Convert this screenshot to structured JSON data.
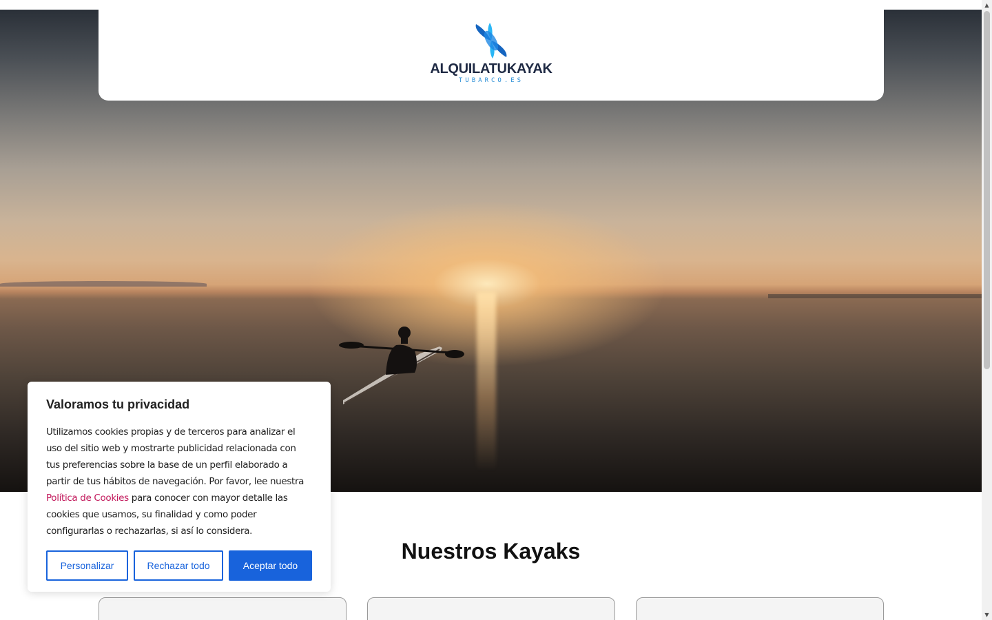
{
  "logo": {
    "name": "ALQUILATUKAYAK",
    "tagline": "TUBARCO.ES",
    "colors": {
      "primary": "#1565c0",
      "light": "#29b6f6",
      "text": "#1f2a44"
    }
  },
  "hero": {
    "image": "sunset-kayaker-photo"
  },
  "section": {
    "title": "Nuestros Kayaks"
  },
  "cookie_banner": {
    "title": "Valoramos tu privacidad",
    "text_before_link": "Utilizamos cookies propias y de terceros para analizar el uso del sitio web y mostrarte publicidad relacionada con tus preferencias sobre la base de un perfil elaborado a partir de tus hábitos de navegación. Por favor, lee nuestra ",
    "link_text": "Política de Cookies",
    "text_after_link": " para conocer con mayor detalle las cookies que usamos, su finalidad y como poder configurarlas o rechazarlas, si así lo considera.",
    "buttons": {
      "customize": "Personalizar",
      "reject": "Rechazar todo",
      "accept": "Aceptar todo"
    },
    "colors": {
      "accent": "#1863dc",
      "link": "#c2185b"
    }
  },
  "scrollbar": {
    "up_icon": "▲",
    "down_icon": "▼"
  }
}
